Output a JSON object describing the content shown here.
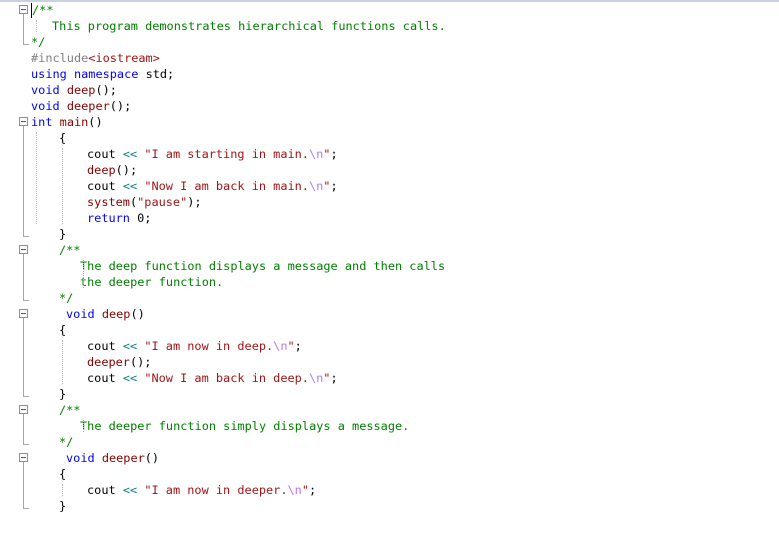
{
  "editor": {
    "lines": [
      {
        "tokens": [
          {
            "t": "/**",
            "c": "cm"
          }
        ]
      },
      {
        "tokens": [
          {
            "t": "This program demonstrates hierarchical functions calls.",
            "c": "cm"
          }
        ]
      },
      {
        "tokens": [
          {
            "t": "*/",
            "c": "cm"
          }
        ]
      },
      {
        "tokens": [
          {
            "t": "#include",
            "c": "pp"
          },
          {
            "t": "<iostream>",
            "c": "inc"
          }
        ]
      },
      {
        "tokens": [
          {
            "t": "using",
            "c": "kw"
          },
          {
            "t": " ",
            "c": "pu"
          },
          {
            "t": "namespace",
            "c": "kw"
          },
          {
            "t": " std;",
            "c": "id"
          }
        ]
      },
      {
        "tokens": [
          {
            "t": "void",
            "c": "kw"
          },
          {
            "t": " ",
            "c": "pu"
          },
          {
            "t": "deep",
            "c": "fn"
          },
          {
            "t": "();",
            "c": "pu"
          }
        ]
      },
      {
        "tokens": [
          {
            "t": "void",
            "c": "kw"
          },
          {
            "t": " ",
            "c": "pu"
          },
          {
            "t": "deeper",
            "c": "fn"
          },
          {
            "t": "();",
            "c": "pu"
          }
        ]
      },
      {
        "tokens": [
          {
            "t": "int",
            "c": "kw"
          },
          {
            "t": " ",
            "c": "pu"
          },
          {
            "t": "main",
            "c": "fn"
          },
          {
            "t": "()",
            "c": "pu"
          }
        ]
      },
      {
        "tokens": [
          {
            "t": "{",
            "c": "pu"
          }
        ]
      },
      {
        "tokens": [
          {
            "t": "cout",
            "c": "id"
          },
          {
            "t": " ",
            "c": "pu"
          },
          {
            "t": "<<",
            "c": "op"
          },
          {
            "t": " ",
            "c": "pu"
          },
          {
            "t": "\"I am starting in main.",
            "c": "str"
          },
          {
            "t": "\\n",
            "c": "esc"
          },
          {
            "t": "\"",
            "c": "str"
          },
          {
            "t": ";",
            "c": "pu"
          }
        ]
      },
      {
        "tokens": [
          {
            "t": "deep",
            "c": "fn"
          },
          {
            "t": "();",
            "c": "pu"
          }
        ]
      },
      {
        "tokens": [
          {
            "t": "cout",
            "c": "id"
          },
          {
            "t": " ",
            "c": "pu"
          },
          {
            "t": "<<",
            "c": "op"
          },
          {
            "t": " ",
            "c": "pu"
          },
          {
            "t": "\"Now I am back in main.",
            "c": "str"
          },
          {
            "t": "\\n",
            "c": "esc"
          },
          {
            "t": "\"",
            "c": "str"
          },
          {
            "t": ";",
            "c": "pu"
          }
        ]
      },
      {
        "tokens": [
          {
            "t": "system",
            "c": "fn"
          },
          {
            "t": "(",
            "c": "pu"
          },
          {
            "t": "\"pause\"",
            "c": "str"
          },
          {
            "t": ");",
            "c": "pu"
          }
        ]
      },
      {
        "tokens": [
          {
            "t": "return",
            "c": "kw"
          },
          {
            "t": " 0;",
            "c": "nm"
          }
        ]
      },
      {
        "tokens": [
          {
            "t": "}",
            "c": "pu"
          }
        ]
      },
      {
        "tokens": [
          {
            "t": "/**",
            "c": "cm"
          }
        ]
      },
      {
        "tokens": [
          {
            "t": "The deep function displays a message and then calls",
            "c": "cm"
          }
        ]
      },
      {
        "tokens": [
          {
            "t": "the deeper function.",
            "c": "cm"
          }
        ]
      },
      {
        "tokens": [
          {
            "t": "*/",
            "c": "cm"
          }
        ]
      },
      {
        "tokens": [
          {
            "t": "void",
            "c": "kw"
          },
          {
            "t": " ",
            "c": "pu"
          },
          {
            "t": "deep",
            "c": "fn"
          },
          {
            "t": "()",
            "c": "pu"
          }
        ]
      },
      {
        "tokens": [
          {
            "t": "{",
            "c": "pu"
          }
        ]
      },
      {
        "tokens": [
          {
            "t": "cout",
            "c": "id"
          },
          {
            "t": " ",
            "c": "pu"
          },
          {
            "t": "<<",
            "c": "op"
          },
          {
            "t": " ",
            "c": "pu"
          },
          {
            "t": "\"I am now in deep.",
            "c": "str"
          },
          {
            "t": "\\n",
            "c": "esc"
          },
          {
            "t": "\"",
            "c": "str"
          },
          {
            "t": ";",
            "c": "pu"
          }
        ]
      },
      {
        "tokens": [
          {
            "t": "deeper",
            "c": "fn"
          },
          {
            "t": "();",
            "c": "pu"
          }
        ]
      },
      {
        "tokens": [
          {
            "t": "cout",
            "c": "id"
          },
          {
            "t": " ",
            "c": "pu"
          },
          {
            "t": "<<",
            "c": "op"
          },
          {
            "t": " ",
            "c": "pu"
          },
          {
            "t": "\"Now I am back in deep.",
            "c": "str"
          },
          {
            "t": "\\n",
            "c": "esc"
          },
          {
            "t": "\"",
            "c": "str"
          },
          {
            "t": ";",
            "c": "pu"
          }
        ]
      },
      {
        "tokens": [
          {
            "t": "}",
            "c": "pu"
          }
        ]
      },
      {
        "tokens": [
          {
            "t": "/**",
            "c": "cm"
          }
        ]
      },
      {
        "tokens": [
          {
            "t": "The deeper function simply displays a message.",
            "c": "cm"
          }
        ]
      },
      {
        "tokens": [
          {
            "t": "*/",
            "c": "cm"
          }
        ]
      },
      {
        "tokens": [
          {
            "t": "void",
            "c": "kw"
          },
          {
            "t": " ",
            "c": "pu"
          },
          {
            "t": "deeper",
            "c": "fn"
          },
          {
            "t": "()",
            "c": "pu"
          }
        ]
      },
      {
        "tokens": [
          {
            "t": "{",
            "c": "pu"
          }
        ]
      },
      {
        "tokens": [
          {
            "t": "cout",
            "c": "id"
          },
          {
            "t": " ",
            "c": "pu"
          },
          {
            "t": "<<",
            "c": "op"
          },
          {
            "t": " ",
            "c": "pu"
          },
          {
            "t": "\"I am now in deeper.",
            "c": "str"
          },
          {
            "t": "\\n",
            "c": "esc"
          },
          {
            "t": "\"",
            "c": "str"
          },
          {
            "t": ";",
            "c": "pu"
          }
        ]
      },
      {
        "tokens": [
          {
            "t": "}",
            "c": "pu"
          }
        ]
      }
    ],
    "colors": {
      "comment": "#008000",
      "keyword": "#0000ff",
      "function": "#880000",
      "preprocessor": "#808080",
      "string": "#a31515",
      "escape": "#b776fb",
      "operator": "#008080"
    }
  }
}
